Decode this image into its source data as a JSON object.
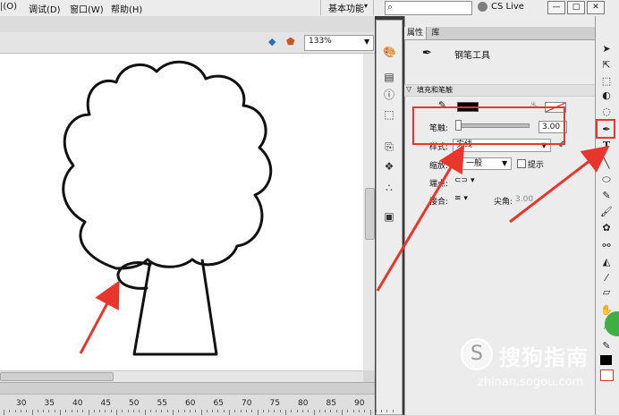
{
  "menubar": {
    "items": [
      "调试(D)",
      "窗口(W)",
      "帮助(H)"
    ],
    "partial_item": "|(O)",
    "workspace_label": "基本功能",
    "workspace_caret": "▾",
    "cs_live_label": "CS Live"
  },
  "window_controls": {
    "minimize": "—",
    "restore": "□",
    "close": "✕"
  },
  "doc_toolbar": {
    "zoom_value": "133%"
  },
  "ruler": {
    "numbers": [
      "30",
      "35",
      "40",
      "45",
      "50",
      "55",
      "60",
      "65",
      "70",
      "75",
      "80",
      "85",
      "90"
    ]
  },
  "properties": {
    "tabs": [
      "属性",
      "库"
    ],
    "tool_name": "钢笔工具",
    "section_title": "填充和笔触",
    "stroke_label": "笔触:",
    "stroke_value": "3.00",
    "style_label": "样式:",
    "style_value": "实线",
    "scale_label": "缩放:",
    "scale_value": "一般",
    "hint_label": "提示",
    "cap_label": "端点:",
    "join_label": "接合:",
    "miter_label": "尖角:",
    "miter_value": "3.00"
  },
  "watermark": {
    "brand": "搜狗指南",
    "url": "zhinan.sogou.com"
  },
  "colors": {
    "highlight_red": "#e8362d",
    "stroke_color": "#000000",
    "fill_color": "#ffffff"
  }
}
